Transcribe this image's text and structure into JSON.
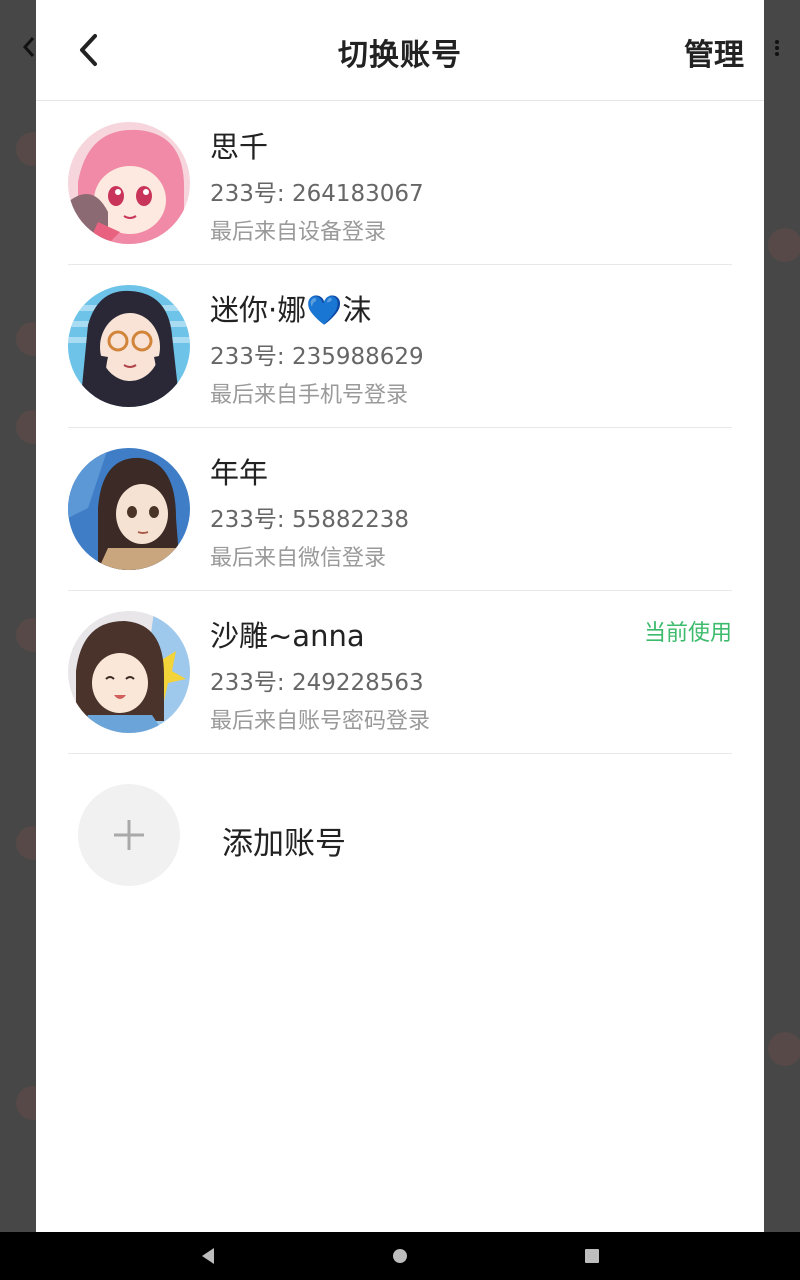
{
  "header": {
    "title": "切换账号",
    "manage_label": "管理"
  },
  "accounts": [
    {
      "name": "思千",
      "uid": "233号: 264183067",
      "login": "最后来自设备登录",
      "current": ""
    },
    {
      "name": "迷你·娜💙沫",
      "uid": "233号: 235988629",
      "login": "最后来自手机号登录",
      "current": ""
    },
    {
      "name": "年年",
      "uid": "233号: 55882238",
      "login": "最后来自微信登录",
      "current": ""
    },
    {
      "name": "沙雕~anna",
      "uid": "233号: 249228563",
      "login": "最后来自账号密码登录",
      "current": "当前使用"
    }
  ],
  "add_account": {
    "label": "添加账号"
  },
  "colors": {
    "accent_green": "#3dbb6c",
    "panel_bg": "#ffffff",
    "overlay_bg": "#474747"
  }
}
